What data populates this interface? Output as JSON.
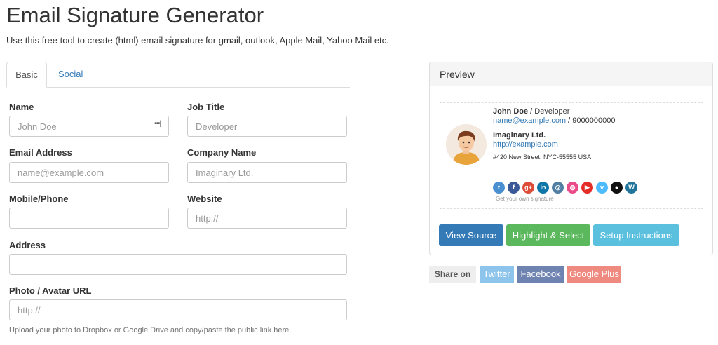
{
  "page": {
    "title": "Email Signature Generator",
    "subtitle": "Use this free tool to create (html) email signature for gmail, outlook, Apple Mail, Yahoo Mail etc."
  },
  "tabs": [
    {
      "label": "Basic",
      "active": true
    },
    {
      "label": "Social",
      "active": false
    }
  ],
  "form": {
    "name": {
      "label": "Name",
      "placeholder": "John Doe"
    },
    "job_title": {
      "label": "Job Title",
      "placeholder": "Developer"
    },
    "email": {
      "label": "Email Address",
      "placeholder": "name@example.com"
    },
    "company": {
      "label": "Company Name",
      "placeholder": "Imaginary Ltd."
    },
    "phone": {
      "label": "Mobile/Phone",
      "placeholder": ""
    },
    "website": {
      "label": "Website",
      "placeholder": "http://"
    },
    "address": {
      "label": "Address",
      "placeholder": ""
    },
    "photo": {
      "label": "Photo / Avatar URL",
      "placeholder": "http://"
    },
    "help_text": "Upload your photo to Dropbox or Google Drive and copy/paste the public link here.",
    "autofill_icon": "•••|"
  },
  "preview": {
    "heading": "Preview",
    "signature": {
      "name": "John Doe",
      "separator": " / ",
      "job_title": "Developer",
      "email": "name@example.com",
      "phone": " / 9000000000",
      "company": "Imaginary Ltd.",
      "website": "http://example.com",
      "address": "#420 New Street, NYC-55555 USA",
      "credit": "Get your own signature"
    },
    "social_icons": [
      {
        "name": "twitter-icon",
        "glyph": "t",
        "color": "#4a8fd0"
      },
      {
        "name": "facebook-icon",
        "glyph": "f",
        "color": "#3b5998"
      },
      {
        "name": "google-plus-icon",
        "glyph": "g+",
        "color": "#dd4b39"
      },
      {
        "name": "linkedin-icon",
        "glyph": "in",
        "color": "#0e76a8"
      },
      {
        "name": "instagram-icon",
        "glyph": "◎",
        "color": "#517fa4"
      },
      {
        "name": "dribbble-icon",
        "glyph": "◍",
        "color": "#ea4c89"
      },
      {
        "name": "youtube-icon",
        "glyph": "▶",
        "color": "#e52d27"
      },
      {
        "name": "vimeo-icon",
        "glyph": "v",
        "color": "#4ebbff"
      },
      {
        "name": "github-icon",
        "glyph": "●",
        "color": "#111111"
      },
      {
        "name": "wordpress-icon",
        "glyph": "W",
        "color": "#21759b"
      }
    ],
    "buttons": {
      "view_source": "View Source",
      "highlight": "Highlight & Select",
      "setup": "Setup Instructions"
    }
  },
  "share": {
    "label": "Share on",
    "twitter": "Twitter",
    "facebook": "Facebook",
    "google_plus": "Google Plus"
  },
  "colors": {
    "view_source": "#337ab7",
    "highlight": "#5cb85c",
    "setup": "#5bc0de",
    "twitter": "#8cc4ec",
    "facebook": "#6f83b0",
    "google_plus": "#ee8a80"
  }
}
